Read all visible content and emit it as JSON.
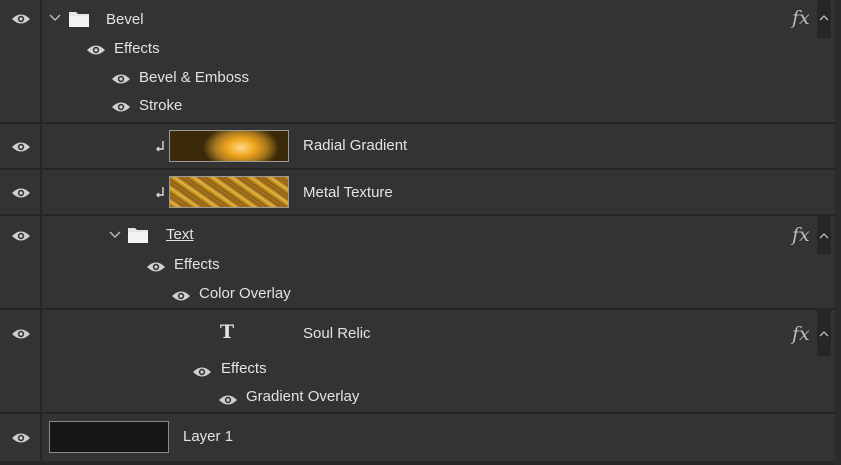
{
  "layers": {
    "bevel": {
      "name": "Bevel",
      "fx": "fx"
    },
    "bevel_effects": {
      "title": "Effects",
      "items": [
        "Bevel & Emboss",
        "Stroke"
      ]
    },
    "radial": {
      "name": "Radial Gradient"
    },
    "metal": {
      "name": "Metal Texture"
    },
    "text_group": {
      "name": "Text",
      "fx": "fx"
    },
    "text_effects": {
      "title": "Effects",
      "items": [
        "Color Overlay"
      ]
    },
    "soul": {
      "name": "Soul Relic",
      "fx": "fx",
      "type_glyph": "T"
    },
    "soul_effects": {
      "title": "Effects",
      "items": [
        "Gradient Overlay"
      ]
    },
    "layer1": {
      "name": "Layer 1"
    }
  },
  "icons": {
    "eye": "eye-icon",
    "folder": "folder-icon",
    "chevron": "chevron-down-icon",
    "collapse": "chevron-up-icon",
    "clip": "clipping-arrow-icon",
    "type": "type-layer-icon"
  },
  "colors": {
    "panel_bg": "#333333",
    "separator": "#262626",
    "text": "#e3e3e3",
    "icon": "#d0d0d0"
  }
}
